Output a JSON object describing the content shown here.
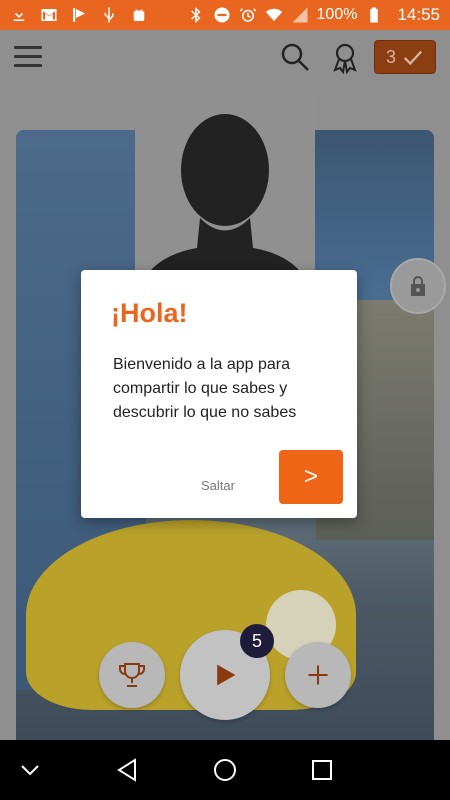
{
  "status_bar": {
    "battery": "100%",
    "time": "14:55",
    "icons_left": [
      "download-icon",
      "gmail-icon",
      "flag-check-icon",
      "usb-icon",
      "android-icon"
    ],
    "icons_right": [
      "bluetooth-icon",
      "dnd-icon",
      "alarm-icon",
      "wifi-icon",
      "signal-icon",
      "battery-icon"
    ]
  },
  "topbar": {
    "done_count": "3"
  },
  "bottom": {
    "play_count": "5"
  },
  "dialog": {
    "title": "¡Hola!",
    "body": "Bienvenido a la app para compartir lo que sabes y descubrir lo que no sabes",
    "skip_label": "Saltar",
    "next_label": ">"
  },
  "colors": {
    "accent": "#e8661f",
    "button": "#ee6516"
  }
}
